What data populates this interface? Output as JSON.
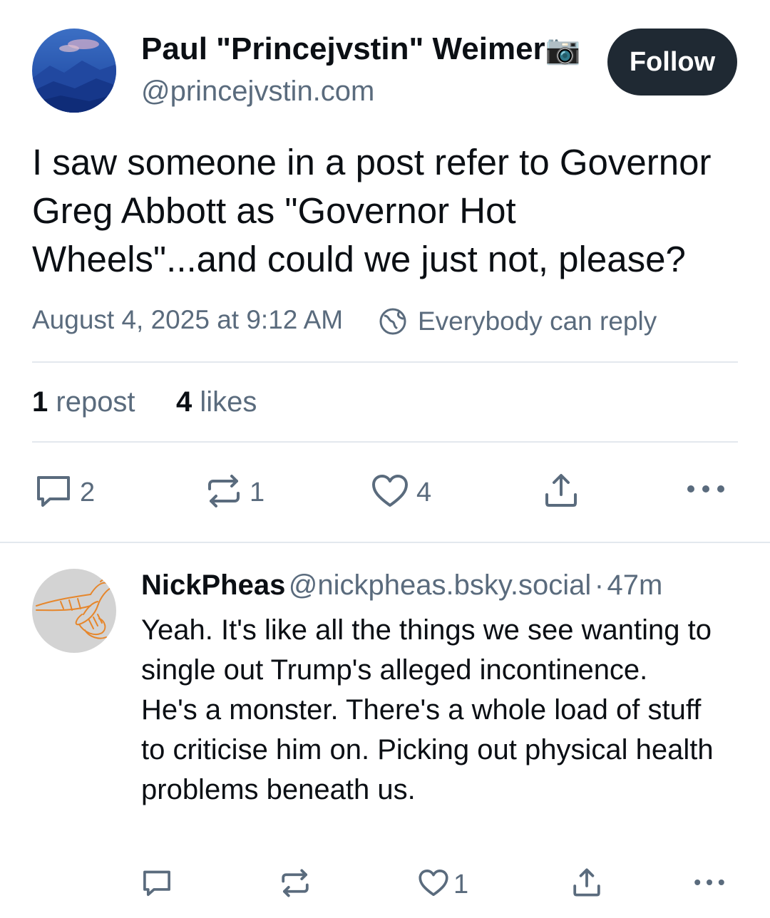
{
  "post": {
    "author_name": "Paul \"Princejvstin\" Weimer",
    "author_emoji": "📷",
    "author_handle": "@princejvstin.com",
    "follow_label": "Follow",
    "text": "I saw someone in a post refer to Governor Greg Abbott as \"Governor Hot Wheels\"...and could we just not, please?",
    "timestamp": "August 4, 2025 at 9:12 AM",
    "reply_setting": "Everybody can reply",
    "stats": {
      "reposts_count": "1",
      "reposts_label": "repost",
      "likes_count": "4",
      "likes_label": "likes"
    },
    "actions": {
      "reply_count": "2",
      "repost_count": "1",
      "like_count": "4"
    }
  },
  "reply": {
    "author_name": "NickPheas",
    "author_handle": "@nickpheas.bsky.social",
    "separator": "·",
    "time": "47m",
    "text": "Yeah. It's like all the things we see wanting to single out Trump's alleged incontinence.\nHe's a monster. There's a whole load of stuff to criticise him on. Picking out physical health problems beneath us.",
    "actions": {
      "like_count": "1"
    }
  },
  "icons": {
    "reply": "speech-bubble-icon",
    "repost": "repost-arrows-icon",
    "like": "heart-icon",
    "share": "share-upload-icon",
    "more": "ellipsis-icon",
    "reply_setting": "globe-icon"
  },
  "colors": {
    "follow_bg": "#1f2933",
    "muted_text": "#5a6b7d",
    "icon": "#5a6b7d"
  }
}
